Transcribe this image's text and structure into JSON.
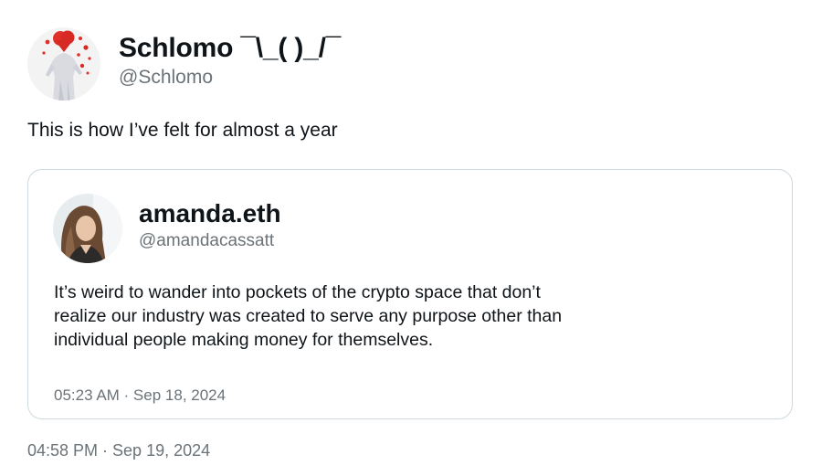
{
  "tweet": {
    "author": {
      "display_name": "Schlomo ¯\\_( )_/¯",
      "handle": "@Schlomo",
      "avatar_icon": "profile-photo"
    },
    "text": "This is how I’ve felt for almost a year",
    "timestamp": "04:58 PM · Sep 19, 2024",
    "quoted_tweet": {
      "author": {
        "display_name": "amanda.eth",
        "handle": "@amandacassatt",
        "avatar_icon": "profile-photo"
      },
      "text_lines": [
        "It’s weird to wander into pockets of the crypto space that don’t",
        "realize our industry was created to serve any purpose other than",
        "individual people making money for themselves."
      ],
      "timestamp": "05:23 AM · Sep 18, 2024"
    }
  },
  "colors": {
    "primary_text": "#0f1419",
    "secondary_text": "#6b7378",
    "card_border": "#cfd9de",
    "avatar_accent": "#e0302a"
  }
}
